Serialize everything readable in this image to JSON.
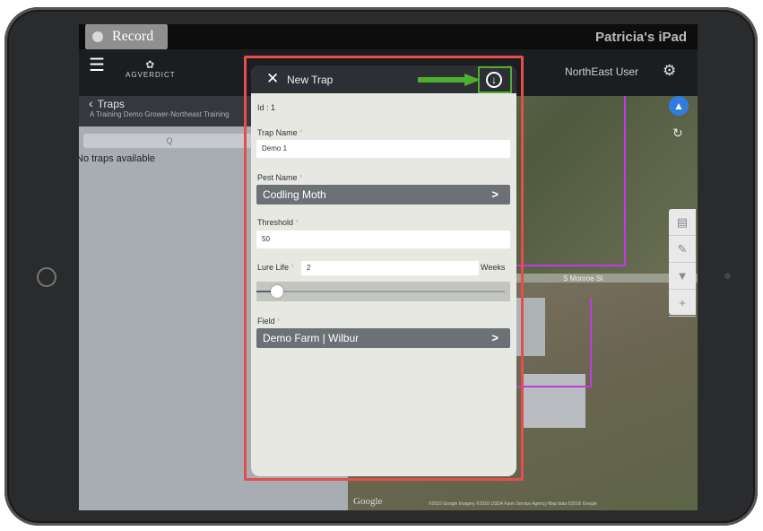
{
  "device": {
    "name": "Patricia's iPad"
  },
  "recorder": {
    "label": "Record"
  },
  "app": {
    "logo_text": "AGVERDICT",
    "user": "NorthEast User"
  },
  "left_panel": {
    "back_label": "Traps",
    "subtitle": "A Training Demo Grower-Northeast Training",
    "search_placeholder": "Q",
    "empty_message": "No traps available"
  },
  "map": {
    "road_label": "S Monroe St",
    "google_label": "Google",
    "attribution": "©2016 Google Imagery ©2016 USDA Farm Service Agency Map data ©2016 Google"
  },
  "modal": {
    "title": "New Trap",
    "id_label": "Id : 1",
    "fields": {
      "trap_name": {
        "label": "Trap Name",
        "value": "Demo 1"
      },
      "pest_name": {
        "label": "Pest Name",
        "value": "Codling Moth"
      },
      "threshold": {
        "label": "Threshold",
        "value": "50"
      },
      "lure_life": {
        "label": "Lure Life",
        "value": "2",
        "units": "Weeks",
        "slider_fraction": 0.02
      },
      "field": {
        "label": "Field",
        "value": "Demo Farm | Wilbur"
      }
    },
    "required_mark": "*"
  },
  "colors": {
    "highlight": "#e64d4d",
    "arrow": "#4fae2d",
    "polygon": "#c13be0",
    "location": "#2f7de0"
  }
}
